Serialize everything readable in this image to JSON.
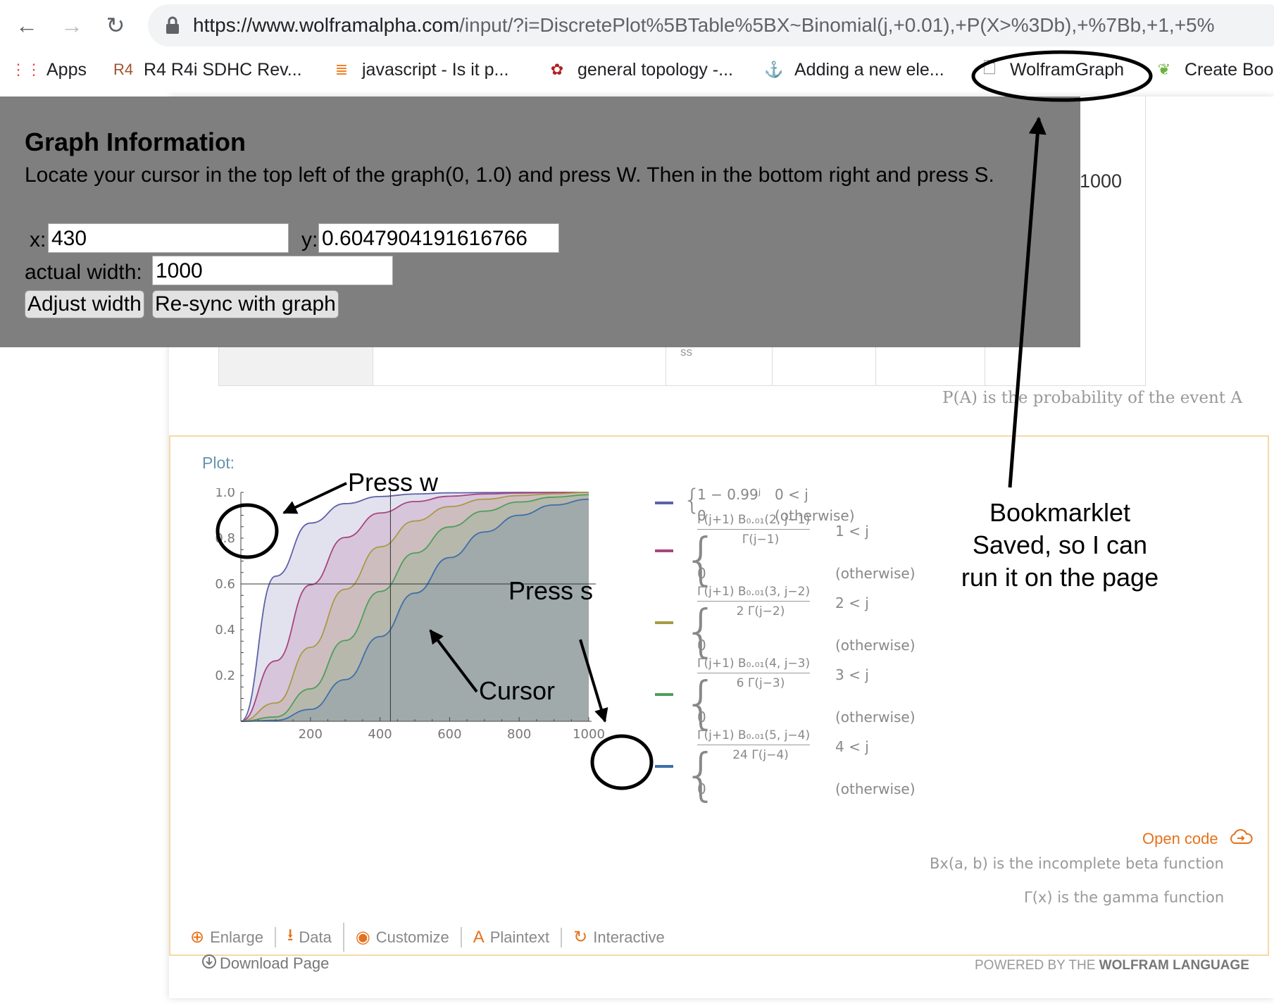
{
  "browser": {
    "url_host": "https://www.wolframalpha.com",
    "url_rest": "/input/?i=DiscretePlot%5BTable%5BX~Binomial(j,+0.01),+P(X>%3Db),+%7Bb,+1,+5%"
  },
  "bookmarks": [
    {
      "label": "Apps",
      "icon": "apps-grid-icon",
      "glyph": "⋮⋮"
    },
    {
      "label": "R4 R4i SDHC Rev...",
      "icon": "r4-logo-icon",
      "glyph": "R4"
    },
    {
      "label": "javascript - Is it p...",
      "icon": "stackoverflow-icon",
      "glyph": "≣"
    },
    {
      "label": "general topology -...",
      "icon": "math-stackexchange-icon",
      "glyph": "✿"
    },
    {
      "label": "Adding a new ele...",
      "icon": "anchor-icon",
      "glyph": "⚓"
    },
    {
      "label": "WolframGraph",
      "icon": "page-icon",
      "glyph": "🗋"
    },
    {
      "label": "Create Boo",
      "icon": "leaf-icon",
      "glyph": "❦"
    }
  ],
  "overlay": {
    "title": "Graph Information",
    "instruction": "Locate your cursor in the top left of the graph(0, 1.0) and press W. Then in the bottom right and press S.",
    "x_label": "x:",
    "x_value": "430",
    "y_label": "y:",
    "y_value": "0.6047904191616766",
    "width_label": "actual width:",
    "width_value": "1000",
    "adjust_button": "Adjust width",
    "resync_button": "Re-sync with graph"
  },
  "result_table": {
    "cell_text": "ss",
    "value_1000": "1000",
    "note": "P(A) is the probability of the event A"
  },
  "plot_pod": {
    "label": "Plot:",
    "open_code": "Open code",
    "footnote_beta": "Bx(a, b) is the incomplete beta function",
    "footnote_gamma": "Γ(x) is the gamma function",
    "toolbar": [
      {
        "label": "Enlarge",
        "icon": "magnify-icon",
        "glyph": "⊕"
      },
      {
        "label": "Data",
        "icon": "download-icon",
        "glyph": "⭳"
      },
      {
        "label": "Customize",
        "icon": "palette-icon",
        "glyph": "◉"
      },
      {
        "label": "Plaintext",
        "icon": "text-a-icon",
        "glyph": "A"
      },
      {
        "label": "Interactive",
        "icon": "interactive-icon",
        "glyph": "↻"
      }
    ]
  },
  "legend": [
    {
      "color": "#5e61a8",
      "num": "1 − 0.99ʲ",
      "den": "",
      "cond": "0 < j",
      "otherwise": "(otherwise)"
    },
    {
      "color": "#a8457f",
      "num": "Γ(j+1) B₀.₀₁(2, j−1)",
      "den": "Γ(j−1)",
      "cond": "1 < j",
      "otherwise": "(otherwise)"
    },
    {
      "color": "#a89a45",
      "num": "Γ(j+1) B₀.₀₁(3, j−2)",
      "den": "2 Γ(j−2)",
      "cond": "2 < j",
      "otherwise": "(otherwise)"
    },
    {
      "color": "#4e9e5a",
      "num": "Γ(j+1) B₀.₀₁(4, j−3)",
      "den": "6 Γ(j−3)",
      "cond": "3 < j",
      "otherwise": "(otherwise)"
    },
    {
      "color": "#3f6fa8",
      "num": "Γ(j+1) B₀.₀₁(5, j−4)",
      "den": "24 Γ(j−4)",
      "cond": "4 < j",
      "otherwise": "(otherwise)"
    }
  ],
  "legend_zero": "0",
  "chart_data": {
    "type": "area",
    "x": [
      0,
      100,
      200,
      300,
      400,
      500,
      600,
      700,
      800,
      900,
      1000
    ],
    "xlim": [
      0,
      1000
    ],
    "ylim": [
      0,
      1.0
    ],
    "xticks": [
      "200",
      "400",
      "600",
      "800",
      "1000"
    ],
    "yticks": [
      "0.2",
      "0.4",
      "0.6",
      "0.8",
      "1.0"
    ],
    "series": [
      {
        "color": "#5e61a8",
        "values": [
          0,
          0.634,
          0.866,
          0.951,
          0.982,
          0.993,
          0.998,
          0.999,
          1.0,
          1.0,
          1.0
        ]
      },
      {
        "color": "#a8457f",
        "values": [
          0,
          0.264,
          0.596,
          0.803,
          0.91,
          0.96,
          0.983,
          0.993,
          0.997,
          0.999,
          1.0
        ]
      },
      {
        "color": "#a89a45",
        "values": [
          0,
          0.08,
          0.323,
          0.577,
          0.762,
          0.875,
          0.938,
          0.97,
          0.986,
          0.994,
          1.0
        ]
      },
      {
        "color": "#4e9e5a",
        "values": [
          0,
          0.019,
          0.142,
          0.353,
          0.567,
          0.735,
          0.849,
          0.918,
          0.958,
          0.979,
          0.99
        ]
      },
      {
        "color": "#3f6fa8",
        "values": [
          0,
          0.004,
          0.052,
          0.182,
          0.37,
          0.56,
          0.715,
          0.827,
          0.9,
          0.945,
          0.97
        ]
      }
    ],
    "cursor": {
      "x": 430,
      "y": 0.6
    }
  },
  "annotations": {
    "press_w": "Press w",
    "press_s": "Press s",
    "cursor": "Cursor",
    "bookmarklet_line1": "Bookmarklet",
    "bookmarklet_line2": "Saved, so I can",
    "bookmarklet_line3": "run it on the page"
  },
  "page_footer": {
    "download": "Download Page",
    "powered_prefix": "POWERED BY THE ",
    "powered_brand": "WOLFRAM LANGUAGE"
  }
}
